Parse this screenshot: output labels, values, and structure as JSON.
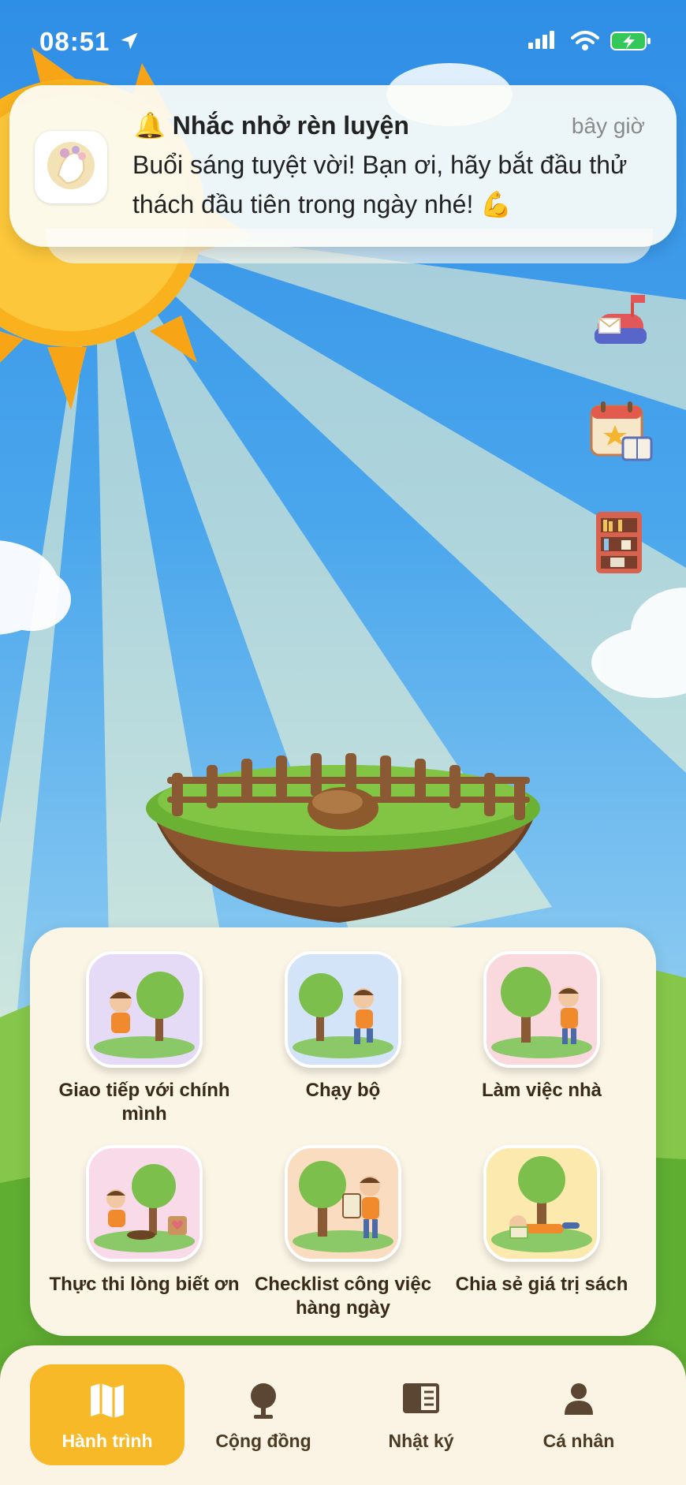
{
  "status_bar": {
    "time": "08:51"
  },
  "notification": {
    "icon": "bell-icon",
    "title": "🔔 Nhắc nhở rèn luyện",
    "time": "bây giờ",
    "body": "Buổi sáng tuyệt vời! Bạn ơi, hãy bắt đầu thử thách đầu tiên trong ngày nhé! 💪"
  },
  "side_icons": [
    "mailbox-icon",
    "calendar-book-icon",
    "bookshelf-icon"
  ],
  "activities": [
    {
      "label": "Giao tiếp với chính mình",
      "color": "#c9b3ef"
    },
    {
      "label": "Chạy bộ",
      "color": "#a9c8f2"
    },
    {
      "label": "Làm việc nhà",
      "color": "#f4b3bf"
    },
    {
      "label": "Thực thi lòng biết ơn",
      "color": "#f1b8d6"
    },
    {
      "label": "Checklist công việc hàng ngày",
      "color": "#f7c18e"
    },
    {
      "label": "Chia sẻ giá trị sách",
      "color": "#f6d676"
    }
  ],
  "tabs": [
    {
      "label": "Hành trình",
      "icon": "map-icon",
      "active": true
    },
    {
      "label": "Cộng đồng",
      "icon": "tree-icon",
      "active": false
    },
    {
      "label": "Nhật ký",
      "icon": "journal-icon",
      "active": false
    },
    {
      "label": "Cá nhân",
      "icon": "person-icon",
      "active": false
    }
  ],
  "colors": {
    "accent": "#f7b928",
    "panel": "#fbf5e6",
    "sky": "#2f8ee6"
  }
}
